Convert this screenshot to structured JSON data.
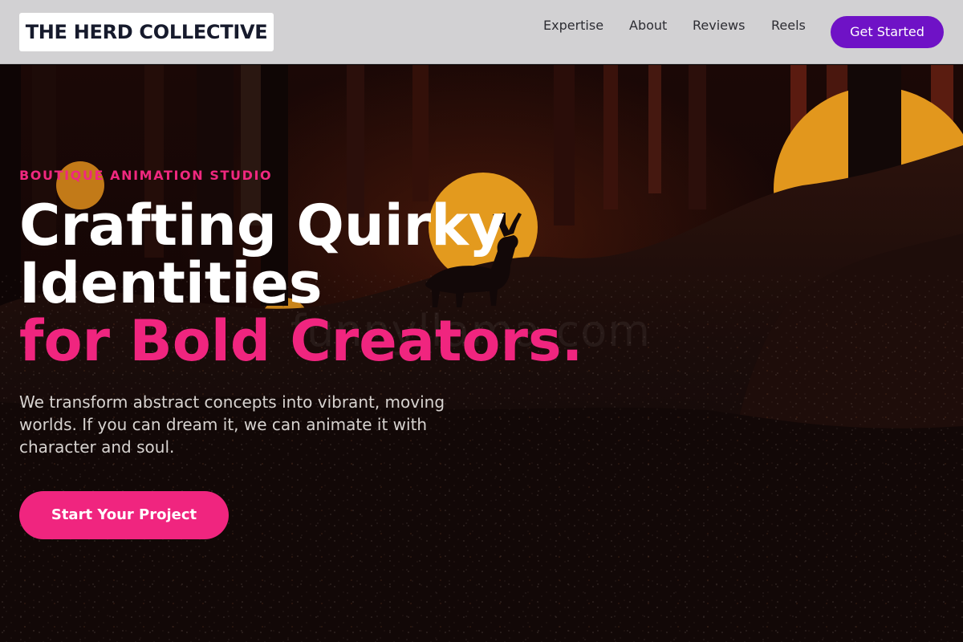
{
  "nav": {
    "logo": "THE HERD COLLECTIVE",
    "links": [
      "Expertise",
      "About",
      "Reviews",
      "Reels"
    ],
    "cta": "Get Started"
  },
  "hero": {
    "eyebrow": "BOUTIQUE ANIMATION STUDIO",
    "headline_line1": "Crafting Quirky",
    "headline_line2": "Identities",
    "headline_accent": "for Bold Creators.",
    "subtext": "We transform abstract concepts into vibrant, moving worlds. If you can dream it, we can animate it with character and soul.",
    "cta": "Start Your Project",
    "watermark": "funnyllama.com",
    "background_image": "dark forest with silhouetted deer before large orange suns"
  },
  "colors": {
    "brand_purple": "#6f12c6",
    "accent_pink": "#f0257f",
    "nav_bg": "#d2d1d3",
    "sun": "#e39a1e",
    "hero_dark": "#0a0606"
  }
}
